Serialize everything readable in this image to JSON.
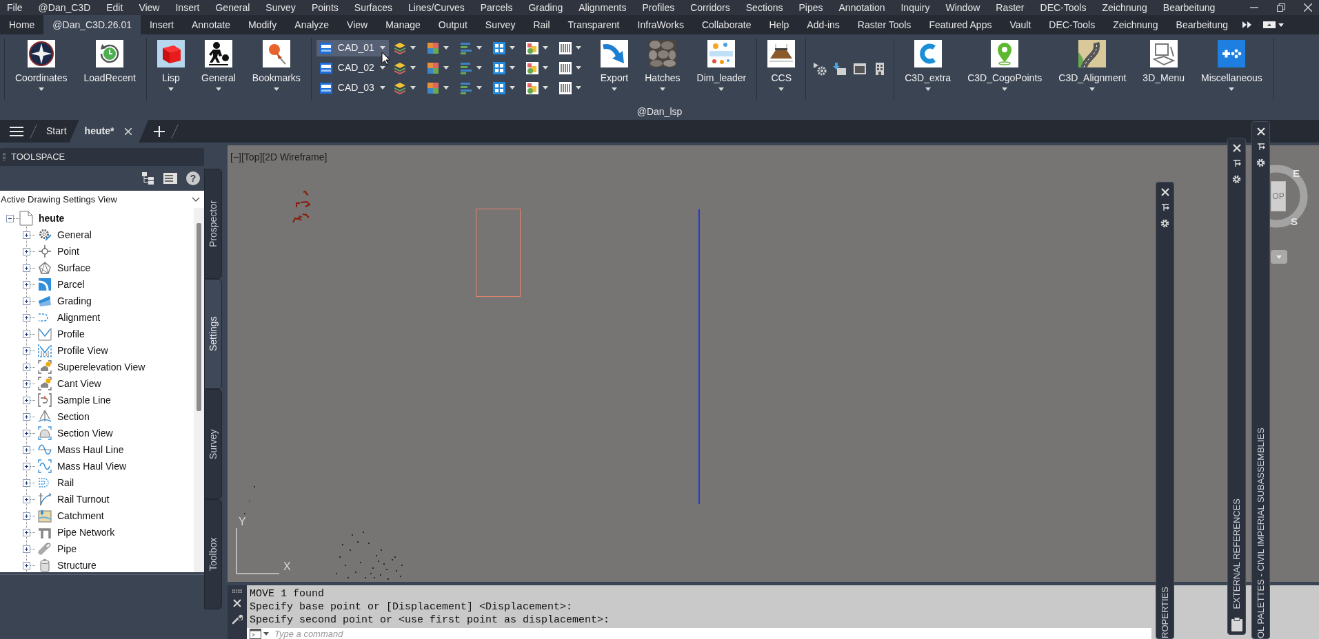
{
  "menu_bar": {
    "items": [
      "File",
      "@Dan_C3D",
      "Edit",
      "View",
      "Insert",
      "General",
      "Survey",
      "Points",
      "Surfaces",
      "Lines/Curves",
      "Parcels",
      "Grading",
      "Alignments",
      "Profiles",
      "Corridors",
      "Sections",
      "Pipes",
      "Annotation",
      "Inquiry",
      "Window",
      "Raster",
      "DEC-Tools",
      "Zeichnung",
      "Bearbeitung"
    ]
  },
  "ribbon": {
    "tabs": [
      {
        "label": "Home",
        "selected": false
      },
      {
        "label": "@Dan_C3D.26.01",
        "selected": true
      },
      {
        "label": "Insert",
        "selected": false
      },
      {
        "label": "Annotate",
        "selected": false
      },
      {
        "label": "Modify",
        "selected": false
      },
      {
        "label": "Analyze",
        "selected": false
      },
      {
        "label": "View",
        "selected": false
      },
      {
        "label": "Manage",
        "selected": false
      },
      {
        "label": "Output",
        "selected": false
      },
      {
        "label": "Survey",
        "selected": false
      },
      {
        "label": "Rail",
        "selected": false
      },
      {
        "label": "Transparent",
        "selected": false
      },
      {
        "label": "InfraWorks",
        "selected": false
      },
      {
        "label": "Collaborate",
        "selected": false
      },
      {
        "label": "Help",
        "selected": false
      },
      {
        "label": "Add-ins",
        "selected": false
      },
      {
        "label": "Raster Tools",
        "selected": false
      },
      {
        "label": "Featured Apps",
        "selected": false
      },
      {
        "label": "Vault",
        "selected": false
      },
      {
        "label": "DEC-Tools",
        "selected": false
      },
      {
        "label": "Zeichnung",
        "selected": false
      },
      {
        "label": "Bearbeitung",
        "selected": false
      }
    ],
    "groups": [
      {
        "kind": "large",
        "buttons": [
          {
            "label": "Coordinates",
            "dropdown": true
          },
          {
            "label": "LoadRecent",
            "dropdown": false
          }
        ]
      },
      {
        "kind": "large",
        "buttons": [
          {
            "label": "Lisp",
            "dropdown": true
          },
          {
            "label": "General",
            "dropdown": true
          },
          {
            "label": "Bookmarks",
            "dropdown": true
          }
        ]
      },
      {
        "kind": "grid",
        "rows": [
          {
            "label": "CAD_01",
            "hovered": true
          },
          {
            "label": "CAD_02",
            "hovered": false
          },
          {
            "label": "CAD_03",
            "hovered": false
          }
        ],
        "buttons": [
          {
            "label": "Export",
            "dropdown": true
          },
          {
            "label": "Hatches",
            "dropdown": true
          },
          {
            "label": "Dim_leader",
            "dropdown": true
          }
        ]
      },
      {
        "kind": "large",
        "buttons": [
          {
            "label": "CCS",
            "dropdown": true
          }
        ]
      },
      {
        "kind": "icons"
      },
      {
        "kind": "large",
        "buttons": [
          {
            "label": "C3D_extra",
            "dropdown": true
          },
          {
            "label": "C3D_CogoPoints",
            "dropdown": true
          },
          {
            "label": "C3D_Alignment",
            "dropdown": true
          },
          {
            "label": "3D_Menu",
            "dropdown": false
          },
          {
            "label": "Miscellaneous",
            "dropdown": true
          }
        ]
      }
    ],
    "panel_title": "@Dan_lsp"
  },
  "file_tabs": [
    {
      "label": "Start",
      "selected": false
    },
    {
      "label": "heute*",
      "selected": true
    }
  ],
  "toolspace": {
    "title": "TOOLSPACE",
    "help": "?",
    "view": "Active Drawing Settings View",
    "tree": {
      "label": "heute",
      "expanded": true,
      "children": [
        {
          "label": "General",
          "expanded": false
        },
        {
          "label": "Point",
          "expanded": false
        },
        {
          "label": "Surface",
          "expanded": false
        },
        {
          "label": "Parcel",
          "expanded": false
        },
        {
          "label": "Grading",
          "expanded": false
        },
        {
          "label": "Alignment",
          "expanded": false
        },
        {
          "label": "Profile",
          "expanded": false
        },
        {
          "label": "Profile View",
          "expanded": false
        },
        {
          "label": "Superelevation View",
          "expanded": false
        },
        {
          "label": "Cant View",
          "expanded": false
        },
        {
          "label": "Sample Line",
          "expanded": false
        },
        {
          "label": "Section",
          "expanded": false
        },
        {
          "label": "Section View",
          "expanded": false
        },
        {
          "label": "Mass Haul Line",
          "expanded": false
        },
        {
          "label": "Mass Haul View",
          "expanded": false
        },
        {
          "label": "Rail",
          "expanded": false
        },
        {
          "label": "Rail Turnout",
          "expanded": false
        },
        {
          "label": "Catchment",
          "expanded": false
        },
        {
          "label": "Pipe Network",
          "expanded": false
        },
        {
          "label": "Pipe",
          "expanded": false
        },
        {
          "label": "Structure",
          "expanded": false
        }
      ]
    },
    "side_tabs": [
      {
        "label": "Prospector",
        "selected": false
      },
      {
        "label": "Settings",
        "selected": true
      },
      {
        "label": "Survey",
        "selected": false
      },
      {
        "label": "Toolbox",
        "selected": false
      }
    ]
  },
  "viewport": {
    "controls": [
      "[−]",
      "[Top]",
      "[2D Wireframe]"
    ],
    "viewcube": {
      "face": "OP",
      "directions": [
        "E",
        "S"
      ]
    },
    "ucs": {
      "x": "X",
      "y": "Y"
    }
  },
  "command_line": {
    "history": [
      "MOVE 1 found",
      "Specify base point or [Displacement] <Displacement>:",
      "Specify second point or <use first point as displacement>:"
    ],
    "placeholder": "Type a command"
  },
  "palettes": [
    {
      "title": "ROPERTIES"
    },
    {
      "title": "EXTERNAL REFERENCES"
    },
    {
      "title": "OL PALETTES - CIVIL IMPERIAL SUBASSEMBLIES"
    }
  ]
}
